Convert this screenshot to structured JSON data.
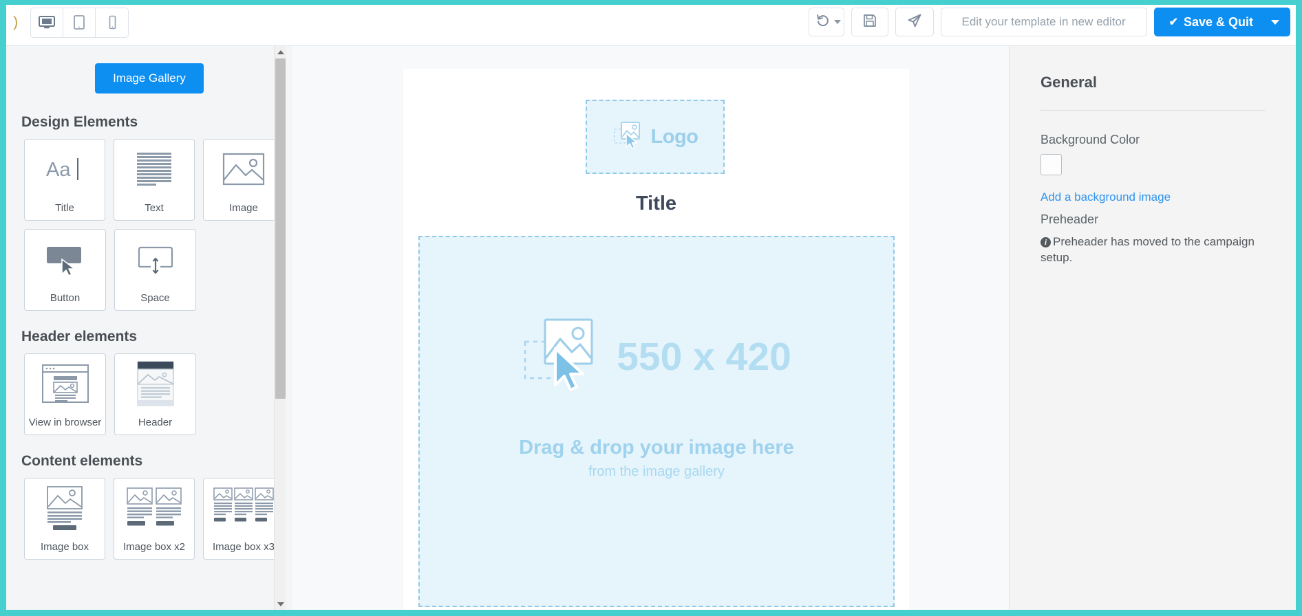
{
  "topbar": {
    "handle_glyph": ")",
    "devices": [
      {
        "name": "desktop-view",
        "icon": "desktop-icon",
        "active": true
      },
      {
        "name": "tablet-view",
        "icon": "tablet-icon",
        "active": false
      },
      {
        "name": "mobile-view",
        "icon": "mobile-icon",
        "active": false
      }
    ],
    "undo_icon": "undo-history-icon",
    "save_icon": "floppy-save-icon",
    "send_icon": "paper-plane-send-icon",
    "new_editor_label": "Edit your template in new editor",
    "save_quit_label": "Save & Quit",
    "save_quit_check": "✔",
    "accent_blue": "#0d8ff2",
    "frame_teal": "#45cfcf"
  },
  "sidebar": {
    "gallery_button": "Image Gallery",
    "sections": [
      {
        "title": "Design Elements",
        "rows": [
          [
            {
              "label": "Title",
              "icon": "title-aa-icon"
            },
            {
              "label": "Text",
              "icon": "text-lines-icon"
            },
            {
              "label": "Image",
              "icon": "image-placeholder-icon"
            }
          ],
          [
            {
              "label": "Button",
              "icon": "button-cursor-icon"
            },
            {
              "label": "Space",
              "icon": "vertical-space-icon"
            }
          ]
        ]
      },
      {
        "title": "Header elements",
        "rows": [
          [
            {
              "label": "View in browser",
              "icon": "browser-window-icon"
            },
            {
              "label": "Header",
              "icon": "header-block-icon"
            }
          ]
        ]
      },
      {
        "title": "Content elements",
        "rows": [
          [
            {
              "label": "Image box",
              "icon": "image-box-icon"
            },
            {
              "label": "Image box x2",
              "icon": "image-box-x2-icon"
            },
            {
              "label": "Image box x3",
              "icon": "image-box-x3-icon"
            }
          ]
        ]
      }
    ]
  },
  "canvas": {
    "logo_label": "Logo",
    "logo_icon": "image-drag-icon",
    "title_text": "Title",
    "dropzone": {
      "dimensions": "550 x 420",
      "icon": "image-drag-icon",
      "line1": "Drag & drop your image here",
      "line2": "from the image gallery"
    }
  },
  "rightpanel": {
    "title": "General",
    "background_color_label": "Background Color",
    "background_color_value": "#ffffff",
    "add_bg_image_link": "Add a background image",
    "preheader_label": "Preheader",
    "preheader_info": "Preheader has moved to the campaign setup.",
    "info_glyph": "i"
  }
}
